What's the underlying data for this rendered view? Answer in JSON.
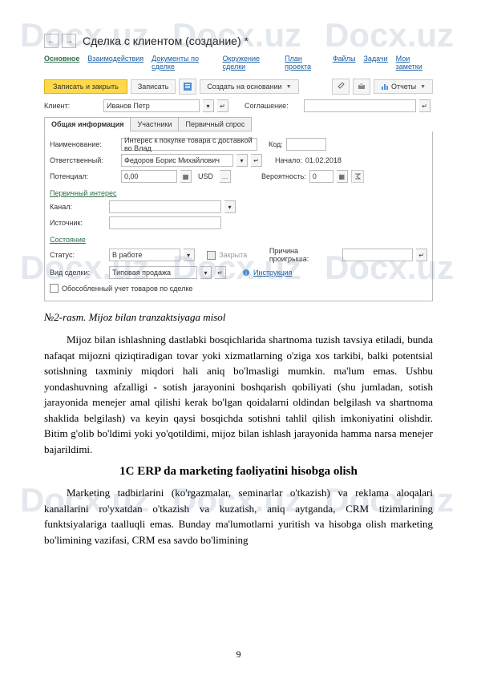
{
  "watermark": "Docx.uz",
  "screenshot": {
    "nav_back": "←",
    "nav_fwd": "→",
    "title": "Сделка с клиентом (создание) *",
    "main_tabs": [
      "Основное",
      "Взаимодействия",
      "Документы по сделке",
      "Окружение сделки",
      "План проекта",
      "Файлы",
      "Задачи",
      "Мои заметки"
    ],
    "toolbar": {
      "save_close": "Записать и закрыть",
      "save": "Записать",
      "create_on": "Создать на основании",
      "reports": "Отчеты"
    },
    "client_lbl": "Клиент:",
    "client_val": "Иванов Петр",
    "agreement_lbl": "Соглашение:",
    "agreement_val": "",
    "inner_tabs": [
      "Общая информация",
      "Участники",
      "Первичный спрос"
    ],
    "name_lbl": "Наименование:",
    "name_val": "Интерес к покупке товара с доставкой во Влад",
    "code_lbl": "Код:",
    "code_val": "",
    "resp_lbl": "Ответственный:",
    "resp_val": "Федоров Борис Михайлович",
    "start_lbl": "Начало:",
    "start_val": "01.02.2018",
    "potential_lbl": "Потенциал:",
    "potential_val": "0,00",
    "currency": "USD",
    "prob_lbl": "Вероятность:",
    "prob_val": "0",
    "sec_interest": "Первичный интерес",
    "channel_lbl": "Канал:",
    "channel_val": "",
    "source_lbl": "Источник:",
    "source_val": "",
    "sec_state": "Состояние",
    "status_lbl": "Статус:",
    "status_val": "В работе",
    "closed_lbl": "Закрыта",
    "reason_lbl": "Причина проигрыша:",
    "reason_val": "",
    "type_lbl": "Вид сделки:",
    "type_val": "Типовая продажа",
    "instruction": "Инструкция",
    "isolated_chk": "Обособленный учет товаров по сделке"
  },
  "doc": {
    "caption": "№2-rasm. Mijoz bilan tranzaktsiyaga misol",
    "para1": "Mijoz bilan ishlashning dastlabki bosqichlarida shartnoma tuzish tavsiya etiladi, bunda nafaqat mijozni qiziqtiradigan tovar yoki xizmatlarning o'ziga xos tarkibi, balki potentsial sotishning taxminiy miqdori hali aniq bo'lmasligi mumkin. ma'lum emas. Ushbu yondashuvning afzalligi - sotish jarayonini boshqarish qobiliyati (shu jumladan, sotish jarayonida menejer amal qilishi kerak bo'lgan qoidalarni oldindan belgilash va shartnoma shaklida belgilash) va keyin qaysi bosqichda sotishni tahlil qilish imkoniyatini olishdir. Bitim g'olib bo'ldimi yoki yo'qotildimi, mijoz bilan ishlash jarayonida hamma narsa menejer bajarildimi.",
    "heading": "1C ERP da marketing faoliyatini hisobga olish",
    "para2": "Marketing tadbirlarini (ko'rgazmalar, seminarlar o'tkazish) va reklama aloqalari kanallarini ro'yxatdan o'tkazish va kuzatish, aniq aytganda, CRM tizimlarining funktsiyalariga taalluqli emas. Bunday ma'lumotlarni yuritish va hisobga olish marketing bo'limining vazifasi, CRM esa savdo bo'limining",
    "page_num": "9"
  }
}
